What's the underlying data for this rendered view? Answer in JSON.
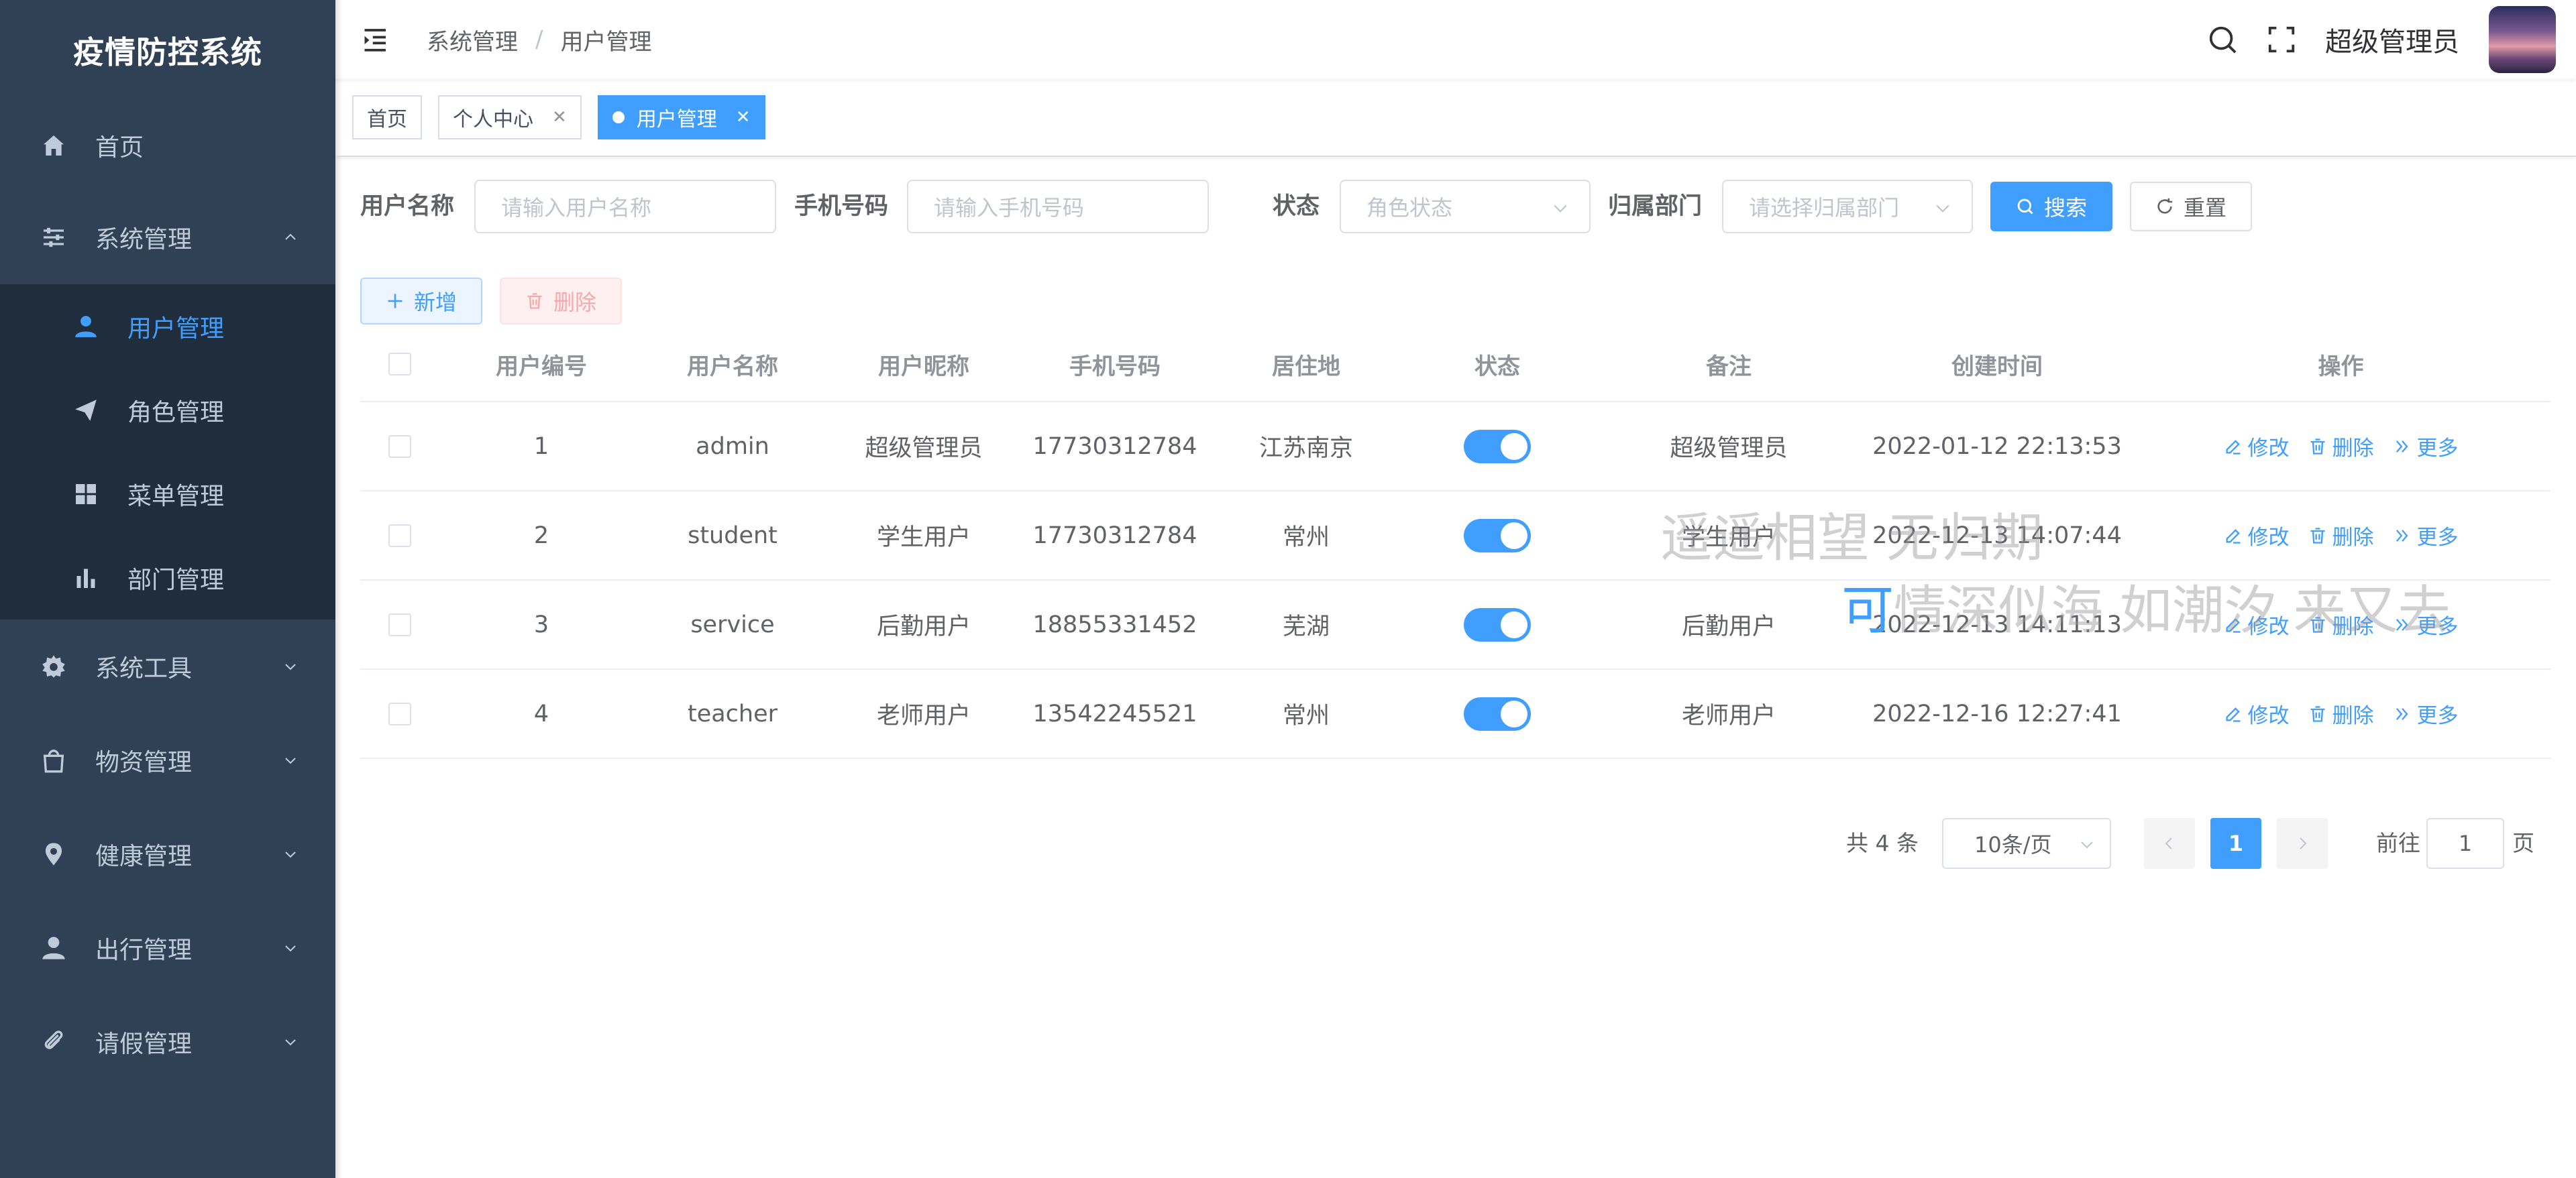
{
  "app": {
    "title": "疫情防控系统"
  },
  "sidebar": {
    "items": [
      {
        "label": "首页",
        "icon": "home-icon"
      },
      {
        "label": "系统管理",
        "icon": "sliders-icon",
        "expanded": true,
        "children": [
          {
            "label": "用户管理",
            "icon": "user-icon",
            "active": true
          },
          {
            "label": "角色管理",
            "icon": "paper-plane-icon"
          },
          {
            "label": "菜单管理",
            "icon": "grid-icon"
          },
          {
            "label": "部门管理",
            "icon": "bar-chart-icon"
          }
        ]
      },
      {
        "label": "系统工具",
        "icon": "gear-icon"
      },
      {
        "label": "物资管理",
        "icon": "bag-icon"
      },
      {
        "label": "健康管理",
        "icon": "location-pin-icon"
      },
      {
        "label": "出行管理",
        "icon": "person-icon"
      },
      {
        "label": "请假管理",
        "icon": "paperclip-icon"
      }
    ]
  },
  "navbar": {
    "breadcrumb": [
      "系统管理",
      "用户管理"
    ],
    "username": "超级管理员"
  },
  "tags": [
    {
      "label": "首页",
      "closable": false,
      "active": false
    },
    {
      "label": "个人中心",
      "closable": true,
      "active": false
    },
    {
      "label": "用户管理",
      "closable": true,
      "active": true
    }
  ],
  "search": {
    "username_label": "用户名称",
    "username_placeholder": "请输入用户名称",
    "phone_label": "手机号码",
    "phone_placeholder": "请输入手机号码",
    "status_label": "状态",
    "status_placeholder": "角色状态",
    "dept_label": "归属部门",
    "dept_placeholder": "请选择归属部门",
    "search_button": "搜索",
    "reset_button": "重置"
  },
  "toolbar": {
    "add_button": "新增",
    "delete_button": "删除"
  },
  "table": {
    "columns": [
      "用户编号",
      "用户名称",
      "用户昵称",
      "手机号码",
      "居住地",
      "状态",
      "备注",
      "创建时间",
      "操作"
    ],
    "rows": [
      {
        "id": "1",
        "username": "admin",
        "nickname": "超级管理员",
        "phone": "17730312784",
        "residence": "江苏南京",
        "status_on": true,
        "remark": "超级管理员",
        "created": "2022-01-12 22:13:53"
      },
      {
        "id": "2",
        "username": "student",
        "nickname": "学生用户",
        "phone": "17730312784",
        "residence": "常州",
        "status_on": true,
        "remark": "学生用户",
        "created": "2022-12-13 14:07:44"
      },
      {
        "id": "3",
        "username": "service",
        "nickname": "后勤用户",
        "phone": "18855331452",
        "residence": "芜湖",
        "status_on": true,
        "remark": "后勤用户",
        "created": "2022-12-13 14:11:13"
      },
      {
        "id": "4",
        "username": "teacher",
        "nickname": "老师用户",
        "phone": "13542245521",
        "residence": "常州",
        "status_on": true,
        "remark": "老师用户",
        "created": "2022-12-16 12:27:41"
      }
    ],
    "actions": {
      "edit": "修改",
      "delete": "删除",
      "more": "更多"
    }
  },
  "pagination": {
    "total_text": "共 4 条",
    "page_size": "10条/页",
    "current_page": "1",
    "jump_prefix": "前往",
    "jump_value": "1",
    "jump_suffix": "页"
  },
  "overlay": {
    "line1": "遥遥相望 无归期",
    "line2_first": "可",
    "line2_rest": "情深似海 如潮汐 来又去"
  },
  "colors": {
    "sidebar_bg": "#304156",
    "submenu_bg": "#1f2d3d",
    "accent": "#409eff",
    "sidebar_text": "#bfcbd9"
  }
}
